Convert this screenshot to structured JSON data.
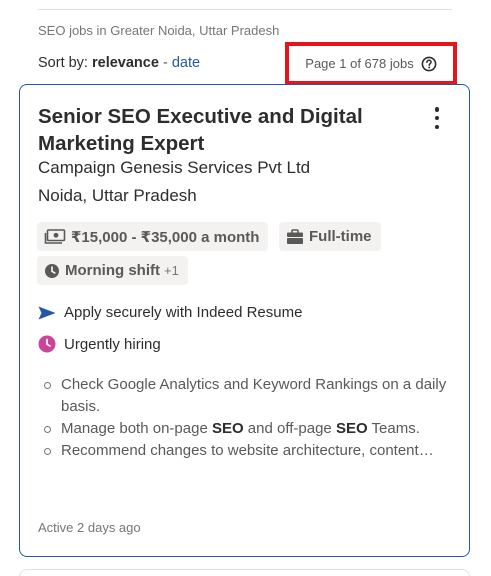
{
  "results": {
    "subtitle": "SEO jobs in Greater Noida, Uttar Pradesh",
    "sort_label": "Sort by:",
    "sort_selected": "relevance",
    "sort_separator": "-",
    "sort_alternate": "date",
    "page_count": "Page 1 of 678 jobs"
  },
  "job": {
    "title": "Senior SEO Executive and Digital Marketing Expert",
    "company": "Campaign Genesis Services Pvt Ltd",
    "location": "Noida, Uttar Pradesh",
    "salary": "₹15,000 - ₹35,000 a month",
    "job_type": "Full-time",
    "shift": "Morning shift",
    "shift_extra": "+1",
    "apply_text": "Apply securely with Indeed Resume",
    "urgent_text": "Urgently hiring",
    "snippet": [
      {
        "pre": "Check Google Analytics and Keyword Rankings on a daily basis."
      },
      {
        "pre": "Manage both on-page ",
        "b1": "SEO",
        "mid": " and off-page ",
        "b2": "SEO",
        "post": " Teams."
      },
      {
        "pre": "Recommend changes to website architecture, content…"
      }
    ],
    "posted": "Active 2 days ago"
  },
  "colors": {
    "accent_blue": "#2557a7",
    "highlight_red": "#e8141c",
    "urgent_pink": "#c84597",
    "chip_bg": "#f3f2f1"
  },
  "icons": {
    "salary": "money-icon",
    "type": "briefcase-icon",
    "shift": "clock-icon",
    "apply": "send-arrow-icon",
    "urgent": "clock-badge-icon",
    "help": "question-circle-icon",
    "menu": "kebab-menu-icon"
  }
}
